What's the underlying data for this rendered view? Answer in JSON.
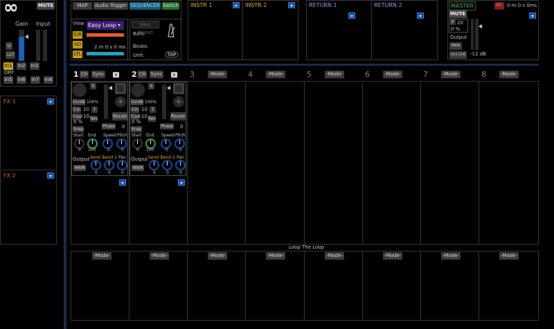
{
  "app": {
    "logo": "∞",
    "mute": "MUTE"
  },
  "input": {
    "gain_label": "Gain",
    "input_label": "Input",
    "u_label": "U",
    "gain_value": "127",
    "dry_label": "DRY",
    "inputs": [
      "In1",
      "In2",
      "In3",
      "In5",
      "In6",
      "In7",
      "In8"
    ]
  },
  "fx": {
    "fx1": "FX 1",
    "fx2": "FX 2"
  },
  "toolbar": {
    "map": "MAP",
    "audio_trigger": "Audio Trigger",
    "sequencer": "SEQUENCER",
    "switch": "Switch"
  },
  "view": {
    "view_label": "View",
    "view_mode": "Easy Loop",
    "sr": "S/R",
    "ad": "AD",
    "ltl": "LTL",
    "time": "2 m 0 s 0 ms",
    "bars_preset": "Bars Preset",
    "bars": "Bars:",
    "beats": "Beats:",
    "unit": "Unit:",
    "tap": "TAP"
  },
  "instr": {
    "instr1": "INSTR 1",
    "instr2": "INSTR 2"
  },
  "returns": {
    "return1": "RETURN 1",
    "return2": "RETURN 2"
  },
  "master": {
    "title": "MASTER",
    "rec": "REC",
    "time": "0 m 0 s 0ms",
    "mute": "MUTE",
    "f": "F",
    "f_value": "20",
    "pct": "0 %",
    "output": "Output",
    "main": "MAIN",
    "ch": "Ch1-Ch6",
    "db": "-12 dB"
  },
  "tracks": [
    {
      "num": "1",
      "ch": "CH",
      "sync": "Sync",
      "x": "x",
      "s": "S",
      "overdub": "Ovrdb",
      "overdub_val": "100%",
      "fin": "F.in",
      "fin_val": "10",
      "t": "T",
      "fout": "F.out",
      "fout_val": "10",
      "pct": "0 %",
      "rev": "Rev",
      "route": "Route",
      "phase": "Phase",
      "phase_val": "0",
      "snap": "Snap",
      "start": "Start",
      "end": "End",
      "speed": "Speed",
      "pitch": "Pitch",
      "start_val": "0",
      "end_val": "100",
      "speed_val": "0",
      "pitch_val": "0",
      "output": "Output",
      "send1": "Send 1",
      "send2": "Send 2",
      "pan": "Pan",
      "main": "MAIN",
      "send1_val": "0",
      "send2_val": "0",
      "pan_val": "0"
    },
    {
      "num": "2",
      "ch": "CH",
      "sync": "Sync",
      "x": "x",
      "s": "S",
      "overdub": "Ovrdb",
      "overdub_val": "100%",
      "fin": "F.in",
      "fin_val": "10",
      "t": "T",
      "fout": "F.out",
      "fout_val": "10",
      "pct": "0 %",
      "rev": "Rev",
      "route": "Route",
      "phase": "Phase",
      "phase_val": "0",
      "snap": "Snap",
      "start": "Start",
      "end": "End",
      "speed": "Speed",
      "pitch": "Pitch",
      "start_val": "0",
      "end_val": "100",
      "speed_val": "0",
      "pitch_val": "0",
      "output": "Output",
      "send1": "Send 1",
      "send2": "Send 2",
      "pan": "Pan",
      "main": "MAIN",
      "send1_val": "0",
      "send2_val": "0",
      "pan_val": "0"
    }
  ],
  "slots": [
    {
      "num": "3",
      "mode": "-Mode-"
    },
    {
      "num": "4",
      "mode": "-Mode-"
    },
    {
      "num": "5",
      "mode": "-Mode-"
    },
    {
      "num": "6",
      "mode": "-Mode-"
    },
    {
      "num": "7",
      "mode": "-Mode-"
    },
    {
      "num": "8",
      "mode": "-Mode-"
    }
  ],
  "loop": {
    "title": "Loop The Loop",
    "modes": [
      "-Mode-",
      "-Mode-",
      "-Mode-",
      "-Mode-",
      "-Mode-",
      "-Mode-",
      "-Mode-",
      "-Mode-"
    ]
  },
  "colors": {
    "orange": "#e8642c",
    "purple": "#b88bff",
    "green": "#3fa34d",
    "blue": "#1a4fa8",
    "yellow": "#c8a020",
    "teal": "#2ea0c0"
  }
}
